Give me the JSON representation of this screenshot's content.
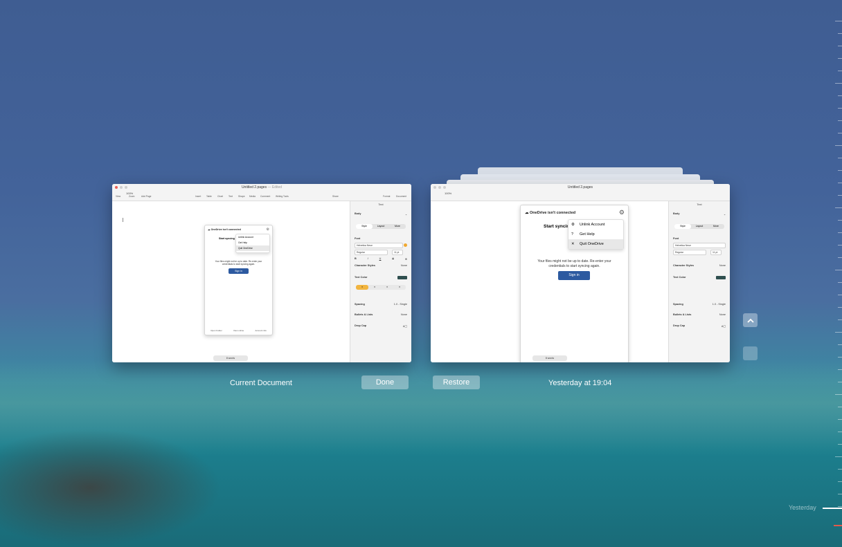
{
  "left_window": {
    "title": "Untitled 2.pages",
    "title_suffix": "— Edited",
    "zoom": "100%",
    "toolbar": [
      "View",
      "Zoom",
      "Add Page",
      "Insert",
      "Table",
      "Chart",
      "Text",
      "Shape",
      "Media",
      "Comment",
      "Writing Tools",
      "Share",
      "Format",
      "Document"
    ],
    "status_pill": "8 words",
    "onedrive": {
      "header": "OneDrive isn't connected",
      "heading": "Start syncing",
      "menu": [
        "Unlink Account",
        "Get Help",
        "Quit OneDrive"
      ],
      "message": "Your files might not be up to date. Re-enter your credentials to start syncing again.",
      "sign_in": "Sign in",
      "footer": [
        "Open Folder",
        "View online",
        "Account info"
      ]
    }
  },
  "right_window": {
    "title": "Untitled 2.pages",
    "zoom": "100%",
    "status_pill": "8 words",
    "onedrive": {
      "header": "OneDrive isn't connected",
      "heading": "Start syncing",
      "menu": [
        "Unlink Account",
        "Get Help",
        "Quit OneDrive"
      ],
      "message_line1": "Your files might not be up to date. Re-enter your",
      "message_line2": "credentials to start syncing again.",
      "sign_in": "Sign in"
    }
  },
  "inspector": {
    "header": "Text",
    "style_name": "Body",
    "tabs": [
      "Style",
      "Layout",
      "More"
    ],
    "font_label": "Font",
    "font_name": "Helvetica Neue",
    "font_weight": "Regular",
    "font_size": "11 pt",
    "format_buttons": [
      "B",
      "I",
      "U",
      "S"
    ],
    "character_styles_label": "Character Styles",
    "character_styles_value": "None",
    "text_color_label": "Text Color",
    "spacing_label": "Spacing",
    "spacing_value": "1.0 - Single",
    "bullets_label": "Bullets & Lists",
    "bullets_value": "None",
    "drop_cap_label": "Drop Cap"
  },
  "labels": {
    "current": "Current Document",
    "version": "Yesterday at 19:04",
    "done": "Done",
    "restore": "Restore",
    "timeline_yesterday": "Yesterday"
  }
}
